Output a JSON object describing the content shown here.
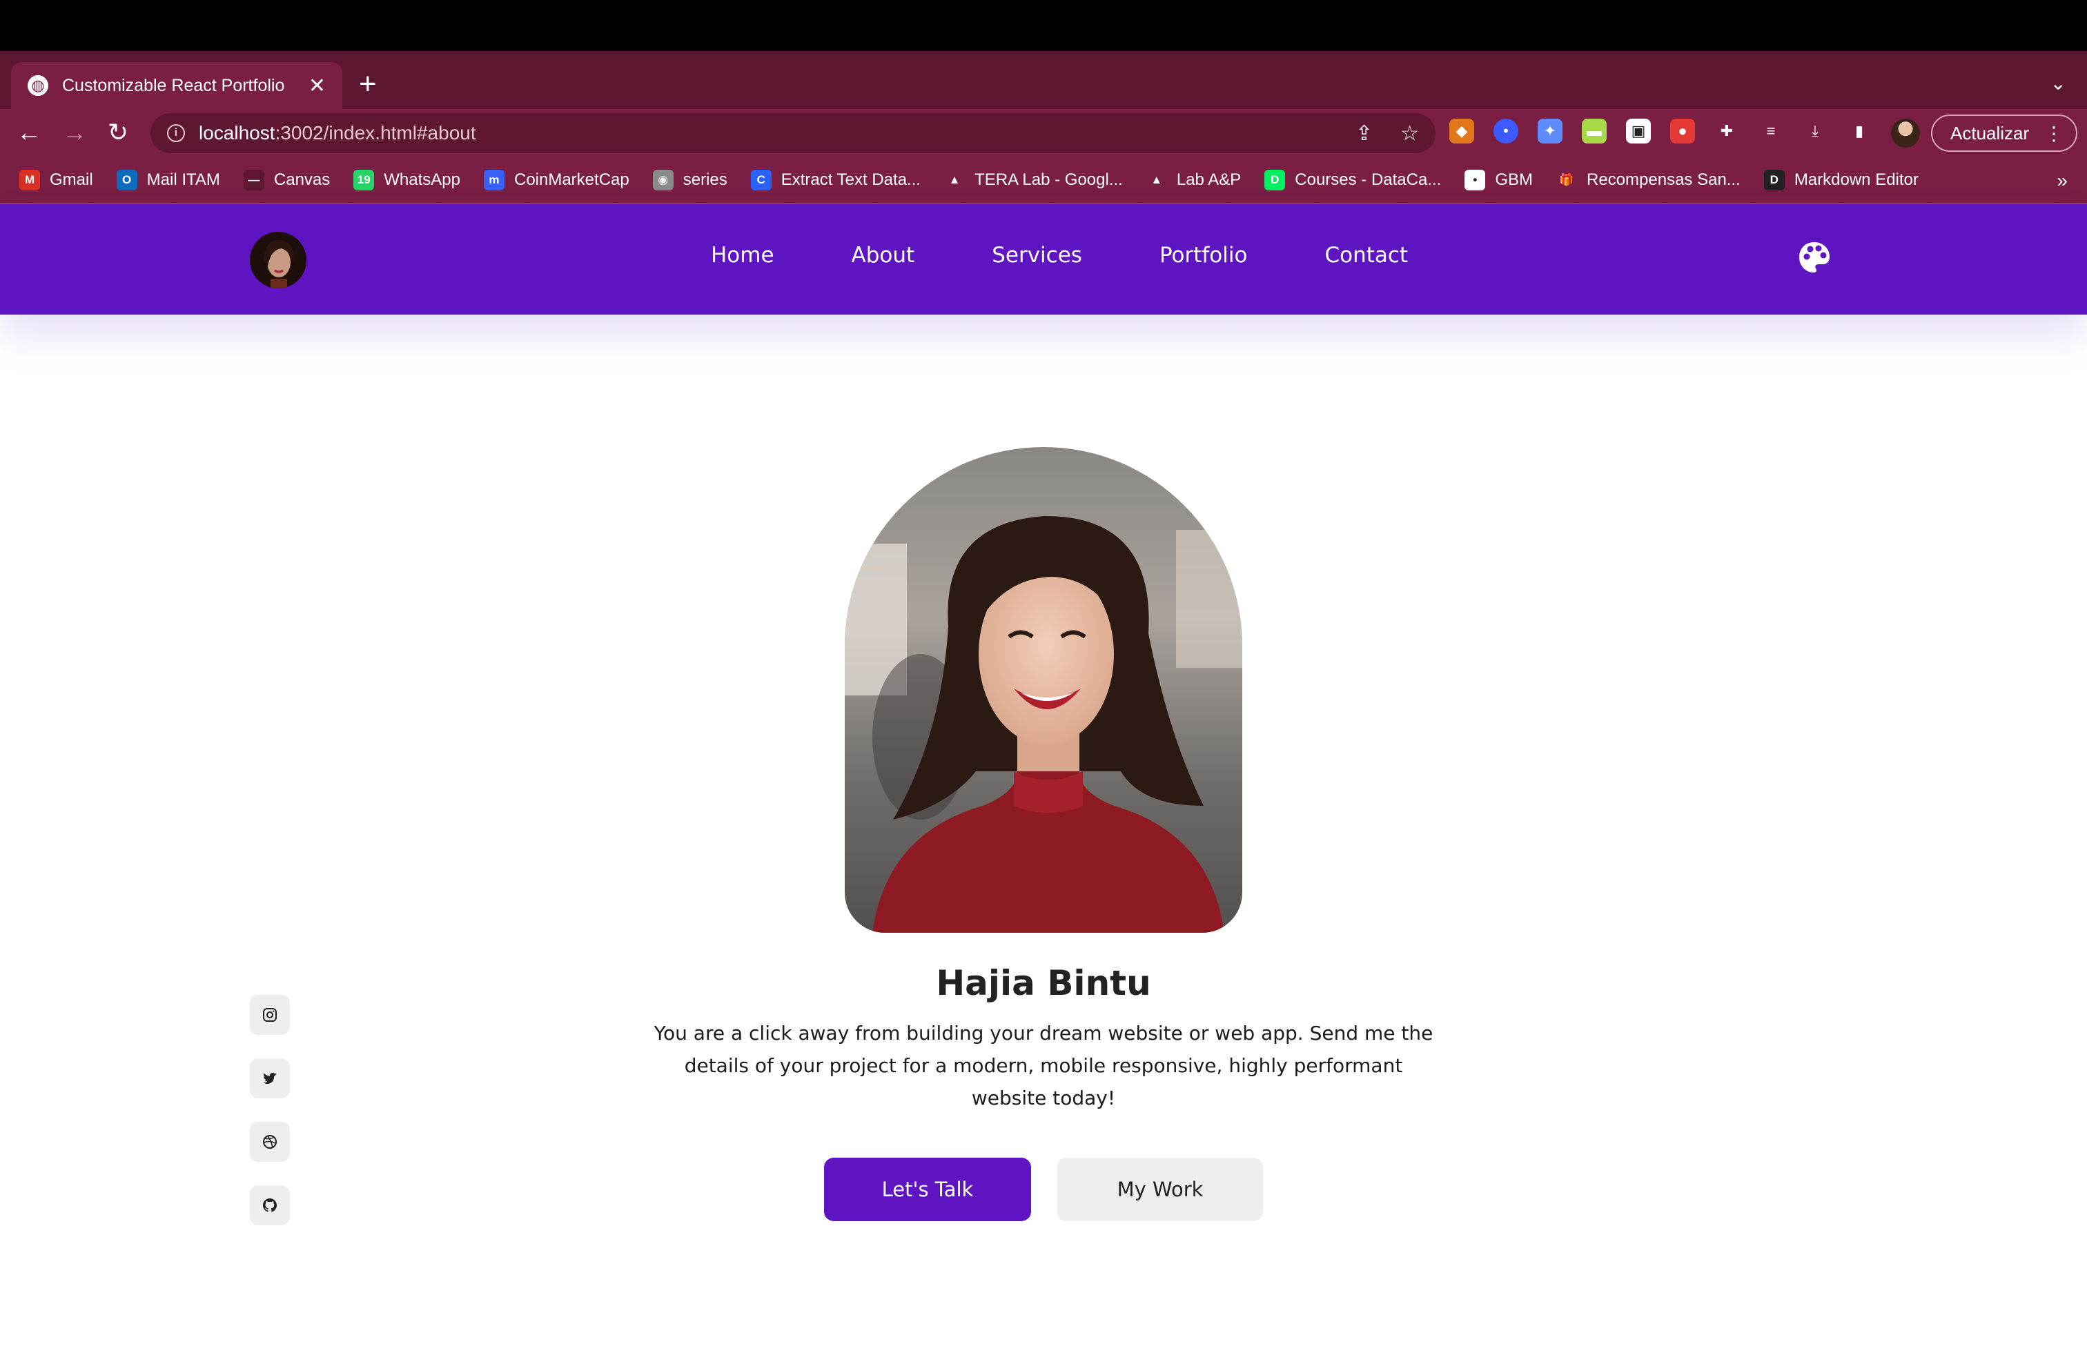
{
  "browser": {
    "tab_title": "Customizable React Portfolio",
    "url_host": "localhost",
    "url_path": ":3002/index.html#about",
    "update_label": "Actualizar",
    "bookmarks": [
      {
        "label": "Gmail",
        "icon": "gmail-icon",
        "color": "#d93025",
        "glyph": "M"
      },
      {
        "label": "Mail ITAM",
        "icon": "outlook-icon",
        "color": "#0f6cbd",
        "glyph": "O"
      },
      {
        "label": "Canvas",
        "icon": "canvas-icon",
        "color": "#5e1733",
        "glyph": "—"
      },
      {
        "label": "WhatsApp",
        "icon": "whatsapp-icon",
        "color": "#25d366",
        "glyph": "19"
      },
      {
        "label": "CoinMarketCap",
        "icon": "coinmarketcap-icon",
        "color": "#3861fb",
        "glyph": "m"
      },
      {
        "label": "series",
        "icon": "series-icon",
        "color": "#8a8a8a",
        "glyph": "◉"
      },
      {
        "label": "Extract Text Data...",
        "icon": "extract-text-icon",
        "color": "#2962ff",
        "glyph": "C"
      },
      {
        "label": "TERA Lab - Googl...",
        "icon": "google-drive-icon",
        "color": "#7a1f43",
        "glyph": "▲"
      },
      {
        "label": "Lab A&P",
        "icon": "google-drive-icon",
        "color": "#7a1f43",
        "glyph": "▲"
      },
      {
        "label": "Courses - DataCa...",
        "icon": "datacamp-icon",
        "color": "#03ef62",
        "glyph": "D"
      },
      {
        "label": "GBM",
        "icon": "gbm-icon",
        "color": "#ffffff",
        "glyph": "•"
      },
      {
        "label": "Recompensas San...",
        "icon": "gift-icon",
        "color": "#7a1f43",
        "glyph": "🎁"
      },
      {
        "label": "Markdown Editor",
        "icon": "markdown-editor-icon",
        "color": "#222222",
        "glyph": "D"
      }
    ]
  },
  "nav": {
    "links": [
      "Home",
      "About",
      "Services",
      "Portfolio",
      "Contact"
    ]
  },
  "hero": {
    "name": "Hajia Bintu",
    "description": "You are a click away from building your dream website or web app. Send me the details of your project for a modern, mobile responsive, highly performant website today!",
    "primary_cta": "Let's Talk",
    "secondary_cta": "My Work"
  },
  "socials": [
    "instagram-icon",
    "twitter-icon",
    "dribbble-icon",
    "github-icon"
  ],
  "colors": {
    "primary": "#5f14c2",
    "browser_frame": "#5e1733",
    "browser_toolbar": "#7a1f43",
    "secondary_button": "#eeeeee"
  }
}
